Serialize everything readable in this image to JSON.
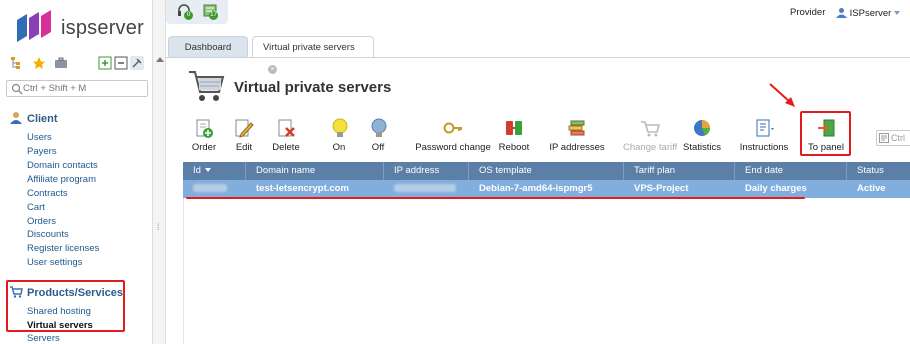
{
  "brand": {
    "name": "ispserver"
  },
  "sidebar": {
    "search_placeholder": "Ctrl + Shift + M",
    "client": {
      "title": "Client",
      "items": [
        "Users",
        "Payers",
        "Domain contacts",
        "Affiliate program",
        "Contracts",
        "Cart",
        "Orders",
        "Discounts",
        "Register licenses",
        "User settings"
      ]
    },
    "products": {
      "title": "Products/Services",
      "items": [
        "Shared hosting",
        "Virtual servers",
        "Servers"
      ],
      "active": "Virtual servers"
    }
  },
  "topbar": {
    "badges": [
      "0",
      "17"
    ],
    "provider_label": "Provider",
    "user_label": "ISPserver"
  },
  "tabs": [
    {
      "label": "Dashboard"
    },
    {
      "label": "Virtual private servers"
    }
  ],
  "page": {
    "title": "Virtual private servers"
  },
  "toolbar": {
    "order": "Order",
    "edit": "Edit",
    "delete": "Delete",
    "on": "On",
    "off": "Off",
    "password_change": "Password change",
    "reboot": "Reboot",
    "ip_addresses": "IP addresses",
    "change_tariff": "Change tariff",
    "statistics": "Statistics",
    "instructions": "Instructions",
    "to_panel": "To panel",
    "search_placeholder": "Ctrl"
  },
  "table": {
    "columns": [
      "Id",
      "Domain name",
      "IP address",
      "OS template",
      "Tariff plan",
      "End date",
      "Status"
    ],
    "rows": [
      {
        "domain": "test-letsencrypt.com",
        "os": "Debian-7-amd64-ispmgr5",
        "tariff": "VPS-Project",
        "end_date": "Daily charges",
        "status": "Active"
      }
    ]
  },
  "colors": {
    "header_bg": "#5b7fa6",
    "selected_row": "#82aedd",
    "annotation_red": "#e21c1c",
    "link": "#1f5a8f"
  }
}
